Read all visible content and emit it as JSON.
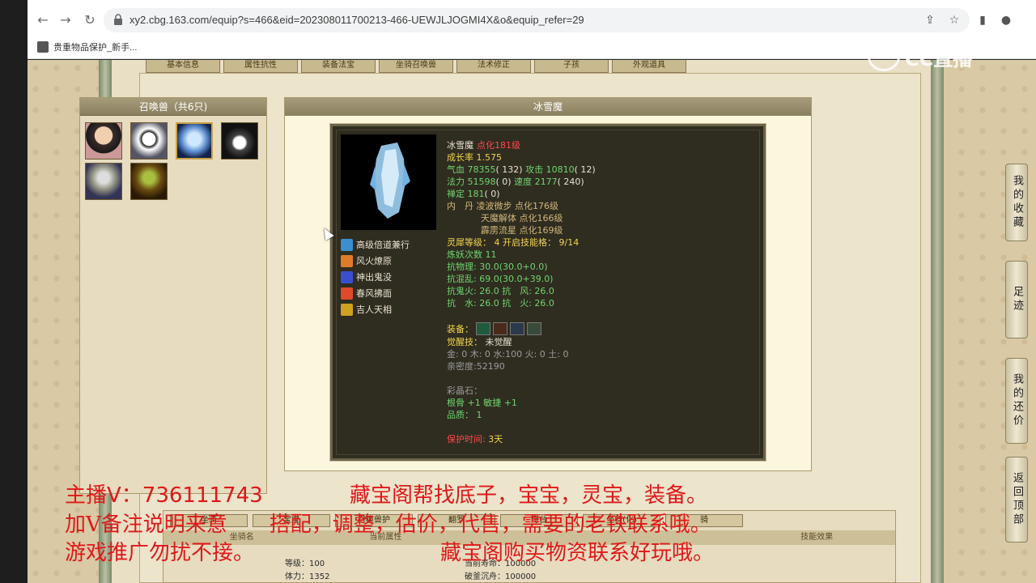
{
  "browser": {
    "url": "xy2.cbg.163.com/equip?s=466&eid=202308011700213-466-UEWJLJOGMI4X&o&equip_refer=29",
    "bookmark_label": "贵重物品保护_新手..."
  },
  "top_tabs": [
    "基本信息",
    "属性抗性",
    "装备法宝",
    "坐骑召唤兽",
    "法术修正",
    "子孩",
    "外观道具"
  ],
  "summon_panel": {
    "title": "召唤兽（共6只)",
    "pets": [
      "pet-1",
      "pet-2",
      "pet-3",
      "pet-4",
      "pet-5",
      "pet-6"
    ]
  },
  "detail": {
    "title": "冰雪魔",
    "name": "冰雪魔",
    "level": "点化181级",
    "growth_label": "成长率",
    "growth": "1.575",
    "hp_label": "气血",
    "hp": "78355",
    "hp_bonus": "( 132)",
    "atk_label": "攻击",
    "atk": "10810",
    "atk_bonus": "( 12)",
    "mp_label": "法力",
    "mp": "51598",
    "mp_bonus": "( 0)",
    "spd_label": "速度",
    "spd": "2177",
    "spd_bonus": "( 240)",
    "zen_label": "禅定",
    "zen": "181",
    "zen_bonus": "( 0)",
    "neidan_label": "内　丹",
    "neidan": [
      "凌波微步 点化176级",
      "天魔解体 点化166级",
      "霹雳流星 点化169级"
    ],
    "lingxi_label": "灵犀等级：",
    "lingxi": "4 开启技能格：",
    "lingxi_slots": "9/14",
    "lianyao": "炼妖次数 11",
    "kang_wuli": "抗物理: 30.0(30.0+0.0)",
    "kang_hunluan": "抗混乱: 69.0(30.0+39.0)",
    "kang_guihuo": "抗鬼火: 26.0 抗　风: 26.0",
    "kang_shui": "抗　水: 26.0 抗　火: 26.0",
    "equip_label": "装备：",
    "awaken_label": "觉醒技：",
    "awaken": "未觉醒",
    "elements": "金: 0 木: 0 水:100 火: 0 土: 0",
    "intimacy": "亲密度:52190",
    "gem_label": "彩晶石：",
    "gem_stats": "根骨 +1 敏捷 +1",
    "quality": "品质： 1",
    "protect_label": "保护时间:",
    "protect_value": "3天",
    "skills": [
      "高级倍道兼行",
      "风火燎原",
      "神出鬼没",
      "春风拂面",
      "吉人天相"
    ]
  },
  "lower": {
    "tabs": [
      "坐骑",
      "宝宝",
      "召唤兽护",
      "翻罗",
      "奇台",
      "坐骑(化)",
      "骑"
    ],
    "headers": [
      "坐骑名",
      "当前属性",
      "",
      "",
      "技能效果"
    ],
    "cells": [
      "等级：100",
      "体力：1352",
      "当前寿命：100000",
      "破釜沉舟：100000"
    ]
  },
  "side_buttons": [
    "我的收藏",
    "足迹",
    "我的还价",
    "返回顶部"
  ],
  "overlay": {
    "line1_left": "主播V：736111743",
    "line1_right": "藏宝阁帮找底子，宝宝，灵宝，装备。",
    "line2": "加V备注说明来意　　搭配，调整，估价，代售，需要的老铁联系哦。",
    "line3_left": "游戏推广勿扰不接。",
    "line3_right": "藏宝阁购买物资联系好玩哦。"
  },
  "watermark": "CC直播",
  "colors": {
    "overlay_red": "#e01818",
    "page_bg": "#d9c9a4",
    "dark_panel": "#2f2c20"
  }
}
